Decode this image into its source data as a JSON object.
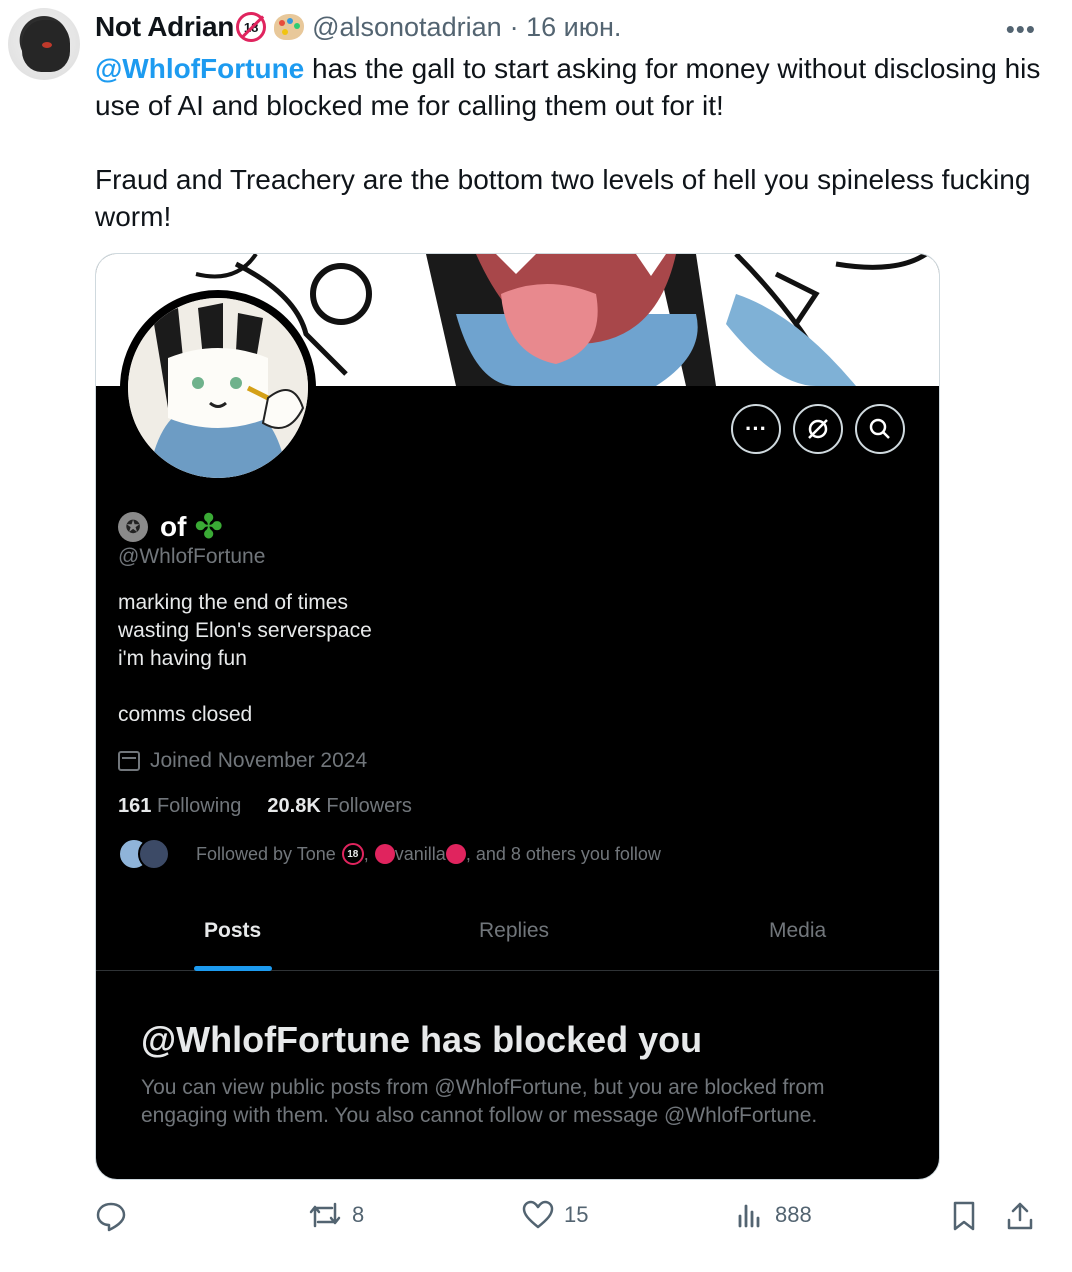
{
  "tweet": {
    "author_name": "Not Adrian",
    "author_handle": "@alsonotadrian",
    "date": "· 16 июн.",
    "more_icon": "more-icon",
    "text_mention": "@WhlofFortune",
    "text_line1": " has the gall to start asking for money without disclosing his use of AI and blocked me for calling them out for it!",
    "text_line2": "Fraud and Treachery are the bottom two levels of hell you  spineless fucking worm!"
  },
  "profile": {
    "name": "of",
    "handle": "@WhlofFortune",
    "bio": [
      "marking the end of times",
      "wasting Elon's serverspace",
      "i'm having fun",
      "",
      "comms closed"
    ],
    "joined": "Joined November 2024",
    "following_count": "161",
    "following_label": "Following",
    "followers_count": "20.8K",
    "followers_label": "Followers",
    "followed_by_prefix": "Followed by Tone",
    "followed_by_badge": "18",
    "followed_by_sep": ",",
    "followed_by_name2": "vanilla",
    "followed_by_suffix": ", and 8 others you follow",
    "tabs": [
      "Posts",
      "Replies",
      "Media"
    ],
    "blocked_title": "@WhlofFortune has blocked you",
    "blocked_text": "You can view public posts from @WhlofFortune, but you are blocked from engaging with them. You also cannot follow or message @WhlofFortune."
  },
  "actions": {
    "reply_count": "",
    "retweet_count": "8",
    "like_count": "15",
    "views_count": "888"
  },
  "colors": {
    "accent": "#1d9bf0",
    "muted": "#536471",
    "dark_bg": "#000000"
  }
}
